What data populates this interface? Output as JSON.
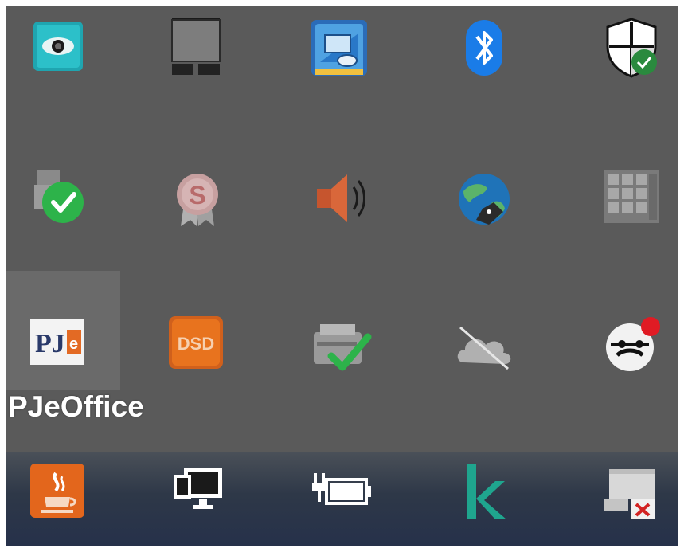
{
  "tray": {
    "tooltip": "PJeOffice",
    "rows": [
      [
        {
          "name": "eye-monitor-icon"
        },
        {
          "name": "display-switch-icon"
        },
        {
          "name": "intel-graphics-icon"
        },
        {
          "name": "bluetooth-icon"
        },
        {
          "name": "windows-security-icon"
        }
      ],
      [
        {
          "name": "sync-check-icon"
        },
        {
          "name": "certificate-s-icon"
        },
        {
          "name": "volume-icon"
        },
        {
          "name": "vpn-globe-icon"
        },
        {
          "name": "keypad-grid-icon"
        }
      ],
      [
        {
          "name": "pjeoffice-icon"
        },
        {
          "name": "dsd-icon"
        },
        {
          "name": "printer-check-icon"
        },
        {
          "name": "onedrive-offline-icon"
        },
        {
          "name": "mascot-notification-icon"
        }
      ],
      [
        {
          "name": "java-icon"
        },
        {
          "name": "network-icon"
        },
        {
          "name": "battery-charging-icon"
        },
        {
          "name": "k-app-icon"
        },
        {
          "name": "usb-device-icon"
        }
      ]
    ]
  },
  "colors": {
    "tray_bg": "#5a5a5a",
    "hover_bg": "#6a6a6a",
    "taskbar": "#2b3547",
    "accent_green": "#2db34a",
    "bluetooth_blue": "#1a7ce8",
    "orange": "#e8731e"
  }
}
